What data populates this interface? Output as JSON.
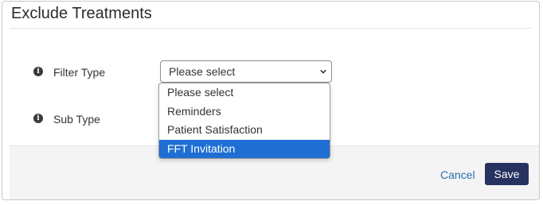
{
  "modal": {
    "title": "Exclude Treatments"
  },
  "form": {
    "filter_type": {
      "label": "Filter Type",
      "value": "Please select"
    },
    "sub_type": {
      "label": "Sub Type"
    }
  },
  "dropdown": {
    "options": [
      "Please select",
      "Reminders",
      "Patient Satisfaction",
      "FFT Invitation"
    ],
    "highlighted": "FFT Invitation"
  },
  "footer": {
    "cancel_label": "Cancel",
    "save_label": "Save"
  },
  "colors": {
    "primary_button": "#263260",
    "link": "#2a6fb3",
    "highlight": "#1f6ed4"
  },
  "icons": {
    "info": "info-circle-icon",
    "select_arrow": "chevron-down-icon"
  }
}
